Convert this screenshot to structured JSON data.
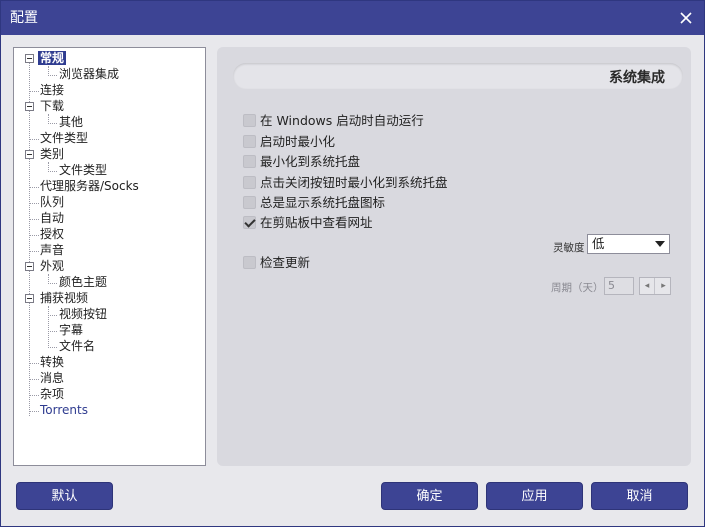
{
  "window": {
    "title": "配置"
  },
  "tree": {
    "items": [
      {
        "label": "常规"
      },
      {
        "label": "浏览器集成"
      },
      {
        "label": "连接"
      },
      {
        "label": "下载"
      },
      {
        "label": "其他"
      },
      {
        "label": "文件类型"
      },
      {
        "label": "类别"
      },
      {
        "label": "文件类型"
      },
      {
        "label": "代理服务器/Socks"
      },
      {
        "label": "队列"
      },
      {
        "label": "自动"
      },
      {
        "label": "授权"
      },
      {
        "label": "声音"
      },
      {
        "label": "外观"
      },
      {
        "label": "颜色主题"
      },
      {
        "label": "捕获视频"
      },
      {
        "label": "视频按钮"
      },
      {
        "label": "字幕"
      },
      {
        "label": "文件名"
      },
      {
        "label": "转换"
      },
      {
        "label": "消息"
      },
      {
        "label": "杂项"
      },
      {
        "label": "Torrents"
      }
    ],
    "selected": "常规"
  },
  "panel": {
    "header": "系统集成",
    "options": [
      {
        "label": "在 Windows 启动时自动运行",
        "checked": false
      },
      {
        "label": "启动时最小化",
        "checked": false
      },
      {
        "label": "最小化到系统托盘",
        "checked": false
      },
      {
        "label": "点击关闭按钮时最小化到系统托盘",
        "checked": false
      },
      {
        "label": "总是显示系统托盘图标",
        "checked": false
      },
      {
        "label": "在剪贴板中查看网址",
        "checked": true
      }
    ],
    "sensitivity": {
      "label": "灵敏度",
      "value": "低"
    },
    "check_updates": {
      "label": "检查更新",
      "checked": false
    },
    "period": {
      "label": "周期（天）",
      "value": "5"
    }
  },
  "buttons": {
    "default": "默认",
    "ok": "确定",
    "apply": "应用",
    "cancel": "取消"
  }
}
